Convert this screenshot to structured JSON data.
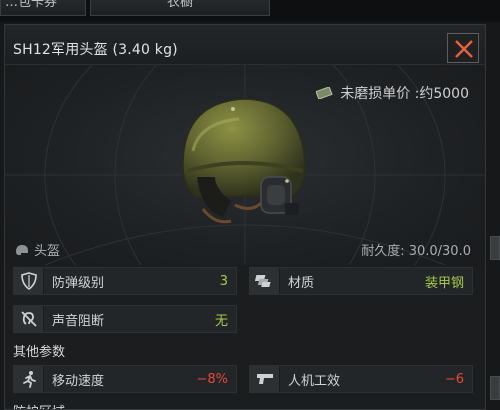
{
  "tabs": {
    "left_label": "…包卡券",
    "right_label": "衣橱"
  },
  "item": {
    "title": "SH12军用头盔 (3.40 kg)",
    "price_label": "未磨损单价 :约5000",
    "category": "头盔",
    "durability": "耐久度: 30.0/30.0"
  },
  "stats": {
    "armor_class": {
      "label": "防弹级别",
      "value": "3",
      "icon": "shield-icon"
    },
    "material": {
      "label": "材质",
      "value": "装甲钢",
      "icon": "armor-plates-icon"
    },
    "sound_block": {
      "label": "声音阻断",
      "value": "无",
      "icon": "ear-muted-icon"
    },
    "other_params_label": "其他参数",
    "move_speed": {
      "label": "移动速度",
      "value": "−8%",
      "icon": "running-man-icon"
    },
    "ergonomics": {
      "label": "人机工效",
      "value": "−6",
      "icon": "pistol-icon"
    },
    "protection_area_label": "防护区域"
  },
  "colors": {
    "positive": "#a4c94b",
    "negative": "#e8473c",
    "close": "#e0623a"
  }
}
